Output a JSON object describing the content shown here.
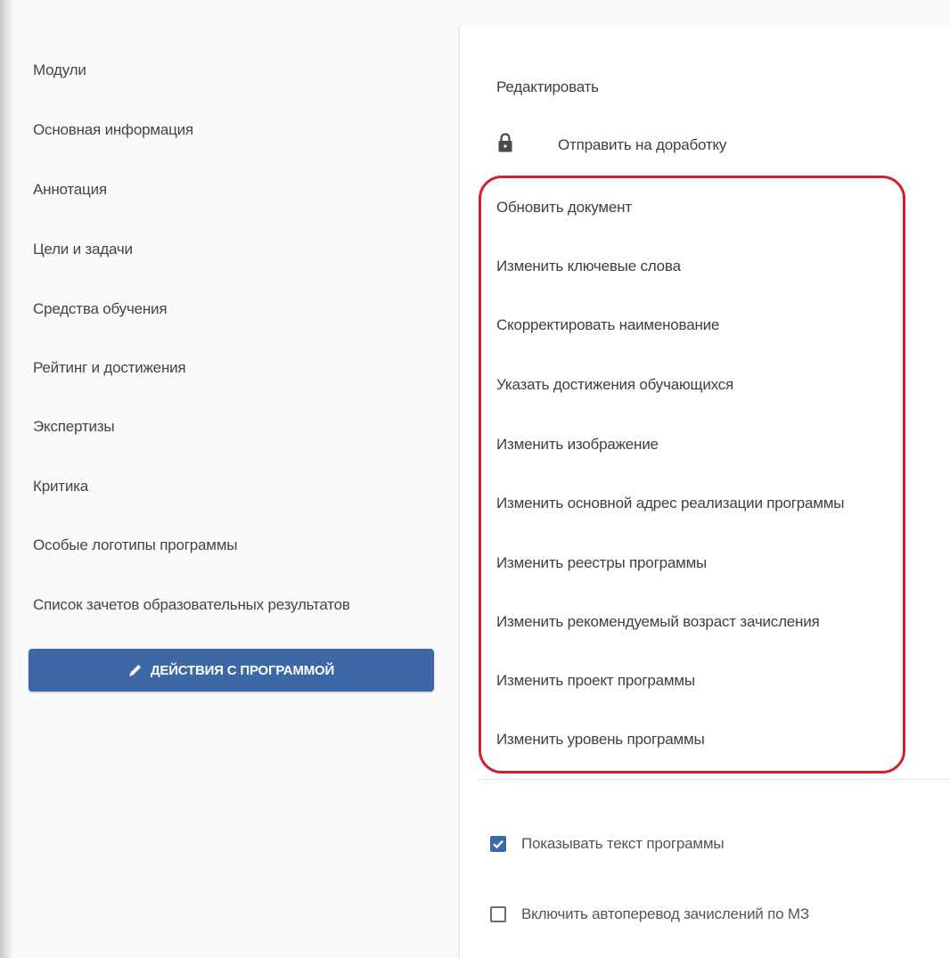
{
  "sidebar": {
    "items": [
      {
        "label": "Модули"
      },
      {
        "label": "Основная информация"
      },
      {
        "label": "Аннотация"
      },
      {
        "label": "Цели и задачи"
      },
      {
        "label": "Средства обучения"
      },
      {
        "label": "Рейтинг и достижения"
      },
      {
        "label": "Экспертизы"
      },
      {
        "label": "Критика"
      },
      {
        "label": "Особые логотипы программы"
      },
      {
        "label": "Список зачетов образовательных результатов"
      }
    ],
    "actions_button": {
      "label": "ДЕЙСТВИЯ С ПРОГРАММОЙ",
      "icon": "pencil-icon"
    }
  },
  "actions_menu": {
    "edit_label": "Редактировать",
    "send_back": {
      "label": "Отправить на доработку",
      "icon": "lock-icon"
    },
    "highlighted_items": [
      {
        "label": "Обновить документ"
      },
      {
        "label": "Изменить ключевые слова"
      },
      {
        "label": "Скорректировать наименование"
      },
      {
        "label": "Указать достижения обучающихся"
      },
      {
        "label": "Изменить изображение"
      },
      {
        "label": "Изменить основной адрес реализации программы"
      },
      {
        "label": "Изменить реестры программы"
      },
      {
        "label": "Изменить рекомендуемый возраст зачисления"
      },
      {
        "label": "Изменить проект программы"
      },
      {
        "label": "Изменить уровень программы"
      }
    ],
    "highlight_color": "#d41f2b"
  },
  "options": {
    "show_text": {
      "label": "Показывать текст программы",
      "checked": true
    },
    "auto_transfer": {
      "label": "Включить автоперевод зачислений по МЗ",
      "checked": false
    }
  },
  "colors": {
    "accent": "#3d68a7",
    "highlight": "#d41f2b",
    "text": "#3f3f3f"
  }
}
